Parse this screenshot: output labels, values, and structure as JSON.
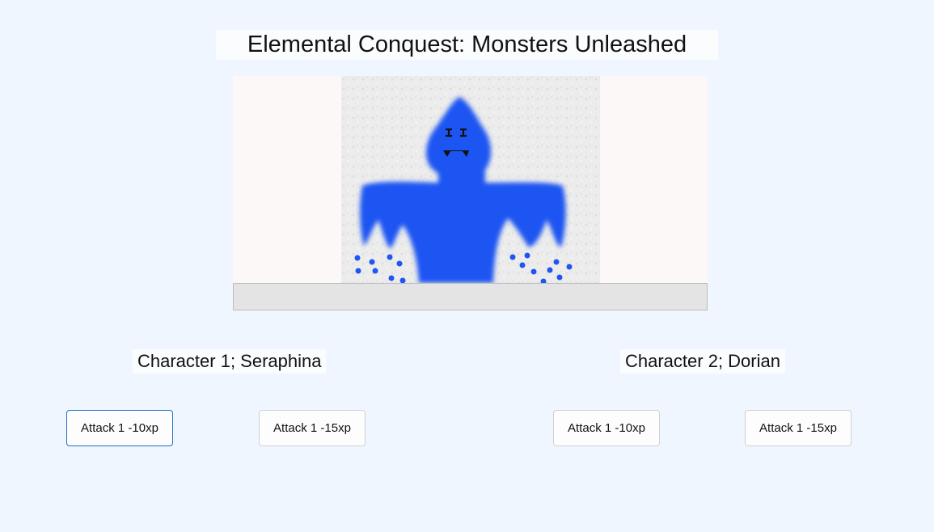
{
  "window": {
    "title": "Elemental Conquest: Monsters Unleashed"
  },
  "monster": {
    "image_icon": "blue-water-monster-icon",
    "color": "#1f55f2"
  },
  "health_bar": {
    "fill_fraction": 0
  },
  "characters": [
    {
      "label": "Character 1; Seraphina",
      "buttons": [
        "Attack 1 -10xp",
        "Attack 1 -15xp"
      ]
    },
    {
      "label": "Character 2; Dorian",
      "buttons": [
        "Attack 1 -10xp",
        "Attack 1 -15xp"
      ]
    }
  ],
  "colors": {
    "background": "#eff6ff",
    "focus_border": "#1e6ec8"
  }
}
